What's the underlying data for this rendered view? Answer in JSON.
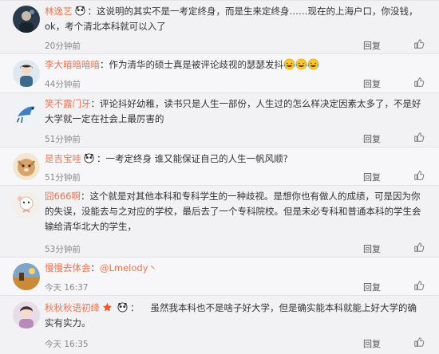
{
  "comments": [
    {
      "user": "林逸艺",
      "text": "这说明的其实不是一考定终身，而是生来定终身……现在的上海户口，你没钱，ok，考个清北本科就可以入了",
      "time": "20分钟前",
      "reply": "回复",
      "avatar_color": "#2b3a4a"
    },
    {
      "user": "李大暗暗暗暗",
      "text": "作为清华的硕士真是被评论歧视的瑟瑟发抖",
      "time": "44分钟前",
      "reply": "回复",
      "avatar_color": "#3b6b8a"
    },
    {
      "user": "笑不露门牙",
      "text": "评论抖好幼稚，读书只是人生一部份，人生过的怎么样决定因素太多了，不是好大学就一定在社会上最厉害的",
      "time": "51分钟前",
      "reply": "回复",
      "avatar_color": "#cfd8e2"
    },
    {
      "user": "是吉宝哇",
      "text": "一考定终身 谁又能保证自己的人生一帆风顺?",
      "time": "51分钟前",
      "reply": "回复",
      "avatar_color": "#d9a36a"
    },
    {
      "user": "囧666啊",
      "text": "这个就是对其他本科和专科学生的一种歧视。是想你也有做人的成绩，可是因为你的失误，没能去与之对应的学校，最后去了一个专科院校。但是未必专科和普通本科的学生会输给清华北大的学生，",
      "time": "53分钟前",
      "reply": "回复",
      "avatar_color": "#e8e0d6"
    },
    {
      "user": "慢慢去体会",
      "mention": "@Lmelody丶",
      "text": "",
      "time": "今天 16:37",
      "reply": "回复",
      "avatar_color": "#c98b3a"
    },
    {
      "user": "秋秋秋语初绛",
      "text": "虽然我本科也不是啥子好大学，但是确实能本科就能上好大学的确实有实力。",
      "time": "今天 16:35",
      "reply": "回复",
      "avatar_color": "#d7c6d8"
    }
  ]
}
